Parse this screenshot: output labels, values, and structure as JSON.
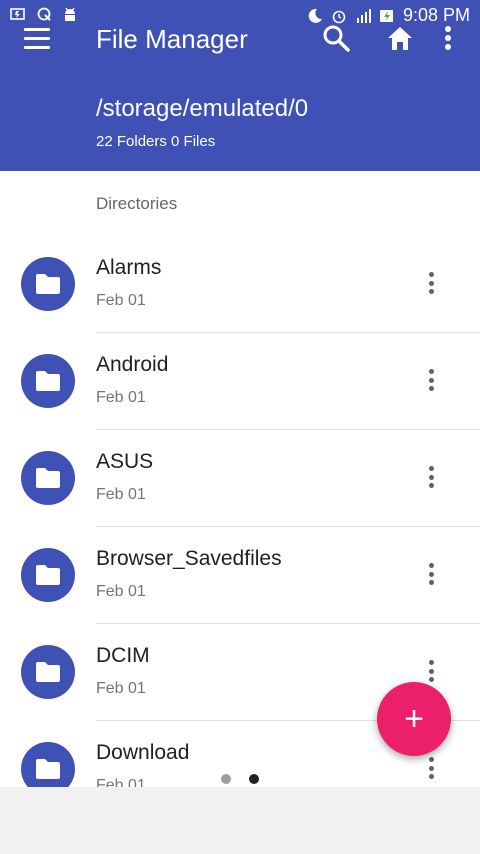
{
  "status_bar": {
    "time": "9:08 PM",
    "left_icons": [
      "battery-saver-icon",
      "sync-icon",
      "android-icon"
    ],
    "right_icons": [
      "moon-icon",
      "alarm-icon",
      "signal-icon",
      "battery-charging-icon"
    ]
  },
  "toolbar": {
    "title": "File Manager",
    "icons": [
      "menu-icon",
      "search-icon",
      "home-icon",
      "more-vert-icon"
    ]
  },
  "header": {
    "path": "/storage/emulated/0",
    "summary": "22 Folders 0 Files"
  },
  "section_title": "Directories",
  "directories": [
    {
      "name": "Alarms",
      "date": "Feb 01"
    },
    {
      "name": "Android",
      "date": "Feb 01"
    },
    {
      "name": "ASUS",
      "date": "Feb 01"
    },
    {
      "name": "Browser_Savedfiles",
      "date": "Feb 01"
    },
    {
      "name": "DCIM",
      "date": "Feb 01"
    },
    {
      "name": "Download",
      "date": "Feb 01"
    }
  ],
  "fab": {
    "label": "+"
  },
  "page_indicator": {
    "count": 2,
    "active_index": 1
  },
  "colors": {
    "primary": "#3f51b5",
    "accent": "#ec1f6b"
  }
}
